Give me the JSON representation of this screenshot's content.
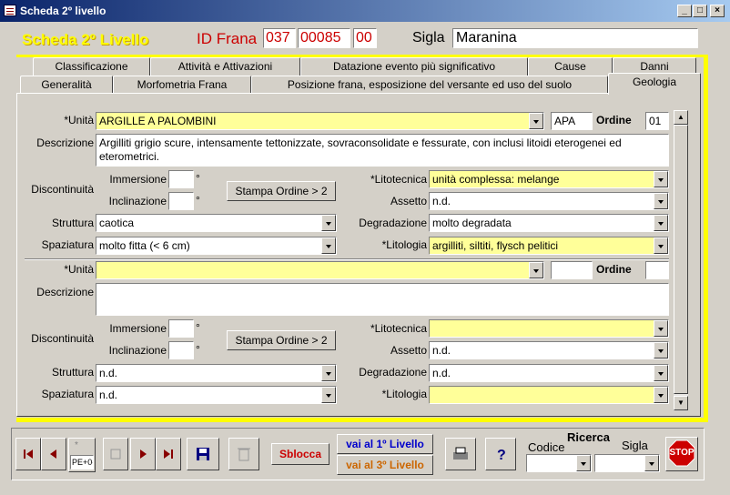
{
  "window": {
    "title": "Scheda 2º livello"
  },
  "header": {
    "form_title": "Scheda 2º Livello",
    "id_label": "ID Frana",
    "id_parts": [
      "037",
      "00085",
      "00"
    ],
    "sigla_label": "Sigla",
    "sigla_value": "Maranina"
  },
  "tabs_row1": [
    "Classificazione",
    "Attività e Attivazioni",
    "Datazione evento più significativo",
    "Cause",
    "Danni"
  ],
  "tabs_row2": [
    "Generalità",
    "Morfometria Frana",
    "Posizione frana, esposizione del versante ed uso del suolo",
    "Geologia"
  ],
  "unit1": {
    "unita_label": "*Unità",
    "unita_value": "ARGILLE A PALOMBINI",
    "sigla_value": "APA",
    "ordine_label": "Ordine",
    "ordine_value": "01",
    "descrizione_label": "Descrizione",
    "descrizione_value": "Argilliti grigio scure, intensamente tettonizzate, sovraconsolidate e fessurate, con inclusi litoidi eterogenei ed eterometrici.",
    "discontinuita_label": "Discontinuità",
    "immersione_label": "Immersione",
    "inclinazione_label": "Inclinazione",
    "degree": "°",
    "stampa_label": "Stampa Ordine > 2",
    "litotecnica_label": "*Litotecnica",
    "litotecnica_value": "unità complessa: melange",
    "assetto_label": "Assetto",
    "assetto_value": "n.d.",
    "struttura_label": "Struttura",
    "struttura_value": "caotica",
    "degradazione_label": "Degradazione",
    "degradazione_value": "molto degradata",
    "spaziatura_label": "Spaziatura",
    "spaziatura_value": "molto fitta (< 6 cm)",
    "litologia_label": "*Litologia",
    "litologia_value": "argilliti, siltiti, flysch pelitici"
  },
  "unit2": {
    "unita_label": "*Unità",
    "unita_value": "",
    "ordine_label": "Ordine",
    "descrizione_label": "Descrizione",
    "discontinuita_label": "Discontinuità",
    "immersione_label": "Immersione",
    "inclinazione_label": "Inclinazione",
    "degree": "°",
    "stampa_label": "Stampa Ordine > 2",
    "litotecnica_label": "*Litotecnica",
    "litotecnica_value": "",
    "assetto_label": "Assetto",
    "assetto_value": "n.d.",
    "struttura_label": "Struttura",
    "struttura_value": "n.d.",
    "degradazione_label": "Degradazione",
    "degradazione_value": "n.d.",
    "spaziatura_label": "Spaziatura",
    "spaziatura_value": "n.d.",
    "litologia_label": "*Litologia",
    "litologia_value": ""
  },
  "footer": {
    "new_record_text": "*",
    "record_field": "PE+0‹",
    "sblocca": "Sblocca",
    "vai1": "vai al 1º Livello",
    "vai3": "vai al 3º Livello",
    "ricerca": "Ricerca",
    "codice": "Codice",
    "sigla": "Sigla",
    "stop": "STOP"
  },
  "colors": {
    "accent_yellow": "#ffff00",
    "field_yellow": "#ffff99",
    "id_red": "#cc0000",
    "title_blue": "#0a246a"
  }
}
